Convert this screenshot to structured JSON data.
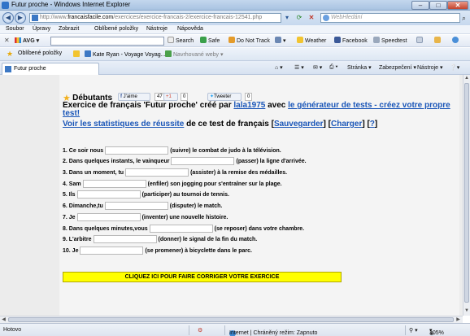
{
  "window": {
    "title": "Futur proche - Windows Internet Explorer"
  },
  "address": {
    "url_pre": "http://www.",
    "url_domain": "francaisfacile.com",
    "url_post": "/exercices/exercice-francais-2/exercice-francais-12541.php",
    "search_placeholder": "WebHledání"
  },
  "menu": [
    "Soubor",
    "Úpravy",
    "Zobrazit",
    "Oblíbené položky",
    "Nástroje",
    "Nápověda"
  ],
  "avg": {
    "logo": "AVG",
    "search_label": "Search",
    "items": [
      "Safe",
      "Do Not Track",
      "Weather",
      "Facebook",
      "Speedtest"
    ]
  },
  "favorites": {
    "label": "Oblíbené položky",
    "items": [
      "Kate Ryan - Voyage Voyag...",
      "Navrhované weby"
    ]
  },
  "tab": {
    "title": "Futur proche"
  },
  "commands": [
    "Stránka",
    "Zabezpečení",
    "Nástroje"
  ],
  "page": {
    "level": "Débutants",
    "like_label": "J'aime",
    "like_count": "47",
    "plus_label": "+1",
    "plus_count": "0",
    "tweet_label": "Tweeter",
    "tweet_count": "0",
    "headline_pre": "Exercice de français 'Futur proche' créé par ",
    "author": "lala1975",
    "headline_mid": " avec ",
    "generator_link": "le générateur de tests - créez votre propre test!",
    "stats_link": "Voir les statistiques de réussite",
    "stats_mid": " de ce test de français [",
    "save_link": "Sauvegarder",
    "sep1": "] [",
    "load_link": "Charger",
    "sep2": "] [",
    "help_link": "?",
    "sep3": "]",
    "correct_button": "CLIQUEZ ICI POUR FAIRE CORRIGER VOTRE EXERCICE"
  },
  "exercises": [
    {
      "before": "1. Ce soir nous",
      "after": "(suivre) le combat de judo à la télévision."
    },
    {
      "before": "2. Dans quelques instants, le vainqueur",
      "after": "(passer) la ligne d'arrivée."
    },
    {
      "before": "3. Dans un moment, tu",
      "after": "(assister) à la remise des médailles."
    },
    {
      "before": "4. Sam",
      "after": "(enfiler) son jogging pour s'entraîner sur la plage."
    },
    {
      "before": "5. Ils",
      "after": "(participer) au tournoi de tennis."
    },
    {
      "before": "6. Dimanche,tu",
      "after": "(disputer) le match."
    },
    {
      "before": "7. Je",
      "after": "(inventer) une nouvelle histoire."
    },
    {
      "before": "8. Dans quelques minutes,vous",
      "after": "(se reposer) dans votre chambre."
    },
    {
      "before": "9. L'arbitre",
      "after": "(donner) le signal de la fin du match."
    },
    {
      "before": "10. Je",
      "after": "(se promener) à bicyclette dans le parc."
    }
  ],
  "status": {
    "left": "Hotovo",
    "zone": "Internet | Chráněný režim: Zapnuto",
    "zoom": "105%"
  }
}
